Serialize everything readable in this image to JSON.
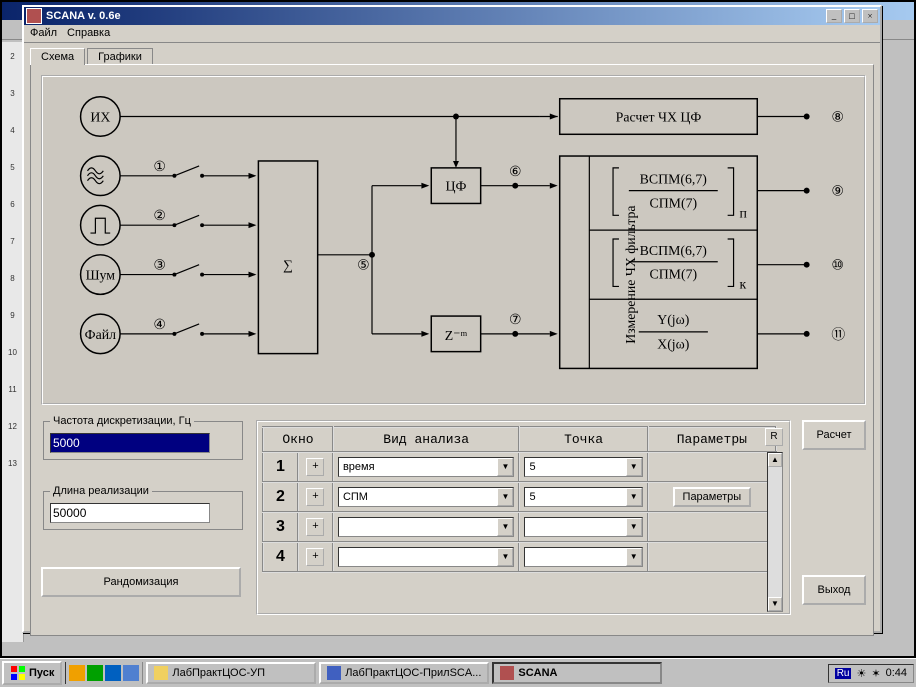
{
  "window": {
    "title": "SCANA v. 0.6e",
    "min": "_",
    "max": "□",
    "close": "×"
  },
  "menu": {
    "file": "Файл",
    "help": "Справка"
  },
  "tabs": {
    "schema": "Схема",
    "charts": "Графики"
  },
  "diagram": {
    "nodes": {
      "ih": "ИХ",
      "noise": "Шум",
      "file": "Файл",
      "sum": "∑",
      "cf": "ЦФ",
      "zm": "Z⁻ᵐ",
      "calc_fr": "Расчет ЧХ ЦФ",
      "meas_fr": "Измерение ЧХ фильтра",
      "frac1_top": "ВСПМ(6,7)",
      "frac1_bot": "СПМ(7)",
      "sub_p": "п",
      "frac2_top": "ВСПМ(6,7)",
      "frac2_bot": "СПМ(7)",
      "sub_k": "к",
      "frac3_top": "Y(jω)",
      "frac3_bot": "X(jω)"
    },
    "labels": {
      "n1": "①",
      "n2": "②",
      "n3": "③",
      "n4": "④",
      "n5": "⑤",
      "n6": "⑥",
      "n7": "⑦",
      "n8": "⑧",
      "n9": "⑨",
      "n10": "⑩",
      "n11": "⑪"
    }
  },
  "controls": {
    "freq_label": "Частота дискретизации, Гц",
    "freq_value": "5000",
    "len_label": "Длина реализации",
    "len_value": "50000",
    "random_btn": "Рандомизация",
    "calc_btn": "Расчет",
    "exit_btn": "Выход"
  },
  "table": {
    "headers": {
      "window": "Окно",
      "analysis": "Вид анализа",
      "point": "Точка",
      "params": "Параметры"
    },
    "r_btn": "R",
    "plus": "+",
    "params_btn": "Параметры",
    "rows": [
      {
        "n": "1",
        "analysis": "время",
        "point": "5",
        "params": false
      },
      {
        "n": "2",
        "analysis": "СПМ",
        "point": "5",
        "params": true
      },
      {
        "n": "3",
        "analysis": "",
        "point": "",
        "params": false
      },
      {
        "n": "4",
        "analysis": "",
        "point": "",
        "params": false
      }
    ]
  },
  "taskbar": {
    "start": "Пуск",
    "items": [
      {
        "label": "ЛабПрактЦОС-УП",
        "active": false
      },
      {
        "label": "ЛабПрактЦОС-ПрилSCA...",
        "active": false
      },
      {
        "label": "SCANA",
        "active": true
      }
    ],
    "lang": "Ru",
    "time": "0:44"
  }
}
